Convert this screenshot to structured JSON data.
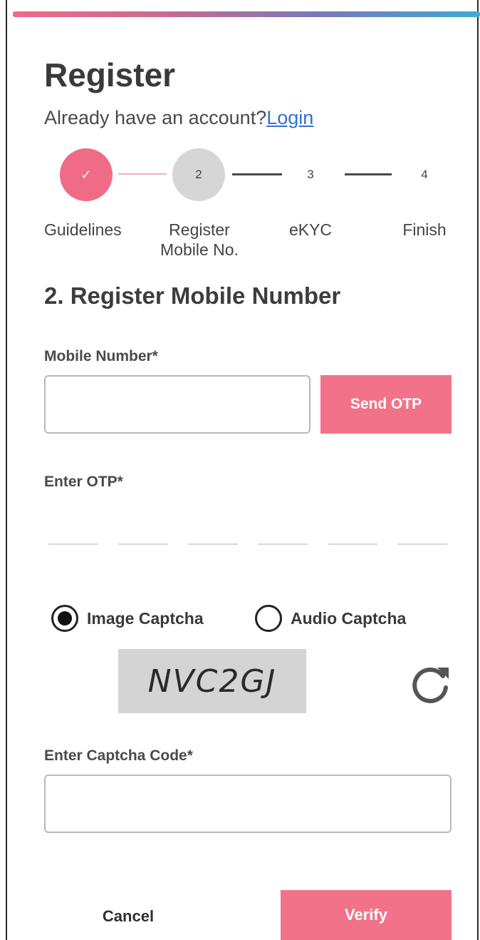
{
  "header": {
    "title": "Register",
    "login_prompt": "Already have an account?",
    "login_link": "Login"
  },
  "stepper": {
    "steps": [
      {
        "number": "1",
        "label": "Guidelines",
        "state": "done"
      },
      {
        "number": "2",
        "label": "Register Mobile No.",
        "state": "current"
      },
      {
        "number": "3",
        "label": "eKYC",
        "state": "pending"
      },
      {
        "number": "4",
        "label": "Finish",
        "state": "pending"
      }
    ],
    "done_icon": "✓"
  },
  "section": {
    "title": "2. Register Mobile Number"
  },
  "mobile": {
    "label": "Mobile Number*",
    "value": "",
    "send_otp": "Send OTP"
  },
  "otp": {
    "label": "Enter OTP*",
    "digits": [
      "",
      "",
      "",
      "",
      "",
      ""
    ]
  },
  "captcha": {
    "option_image": "Image Captcha",
    "option_audio": "Audio Captcha",
    "selected": "image",
    "code": "NVC2GJ",
    "input_label": "Enter Captcha Code*",
    "value": ""
  },
  "actions": {
    "cancel": "Cancel",
    "verify": "Verify"
  },
  "colors": {
    "accent": "#f27389",
    "link": "#2f6fdc",
    "current_step": "#d6d6d6"
  }
}
